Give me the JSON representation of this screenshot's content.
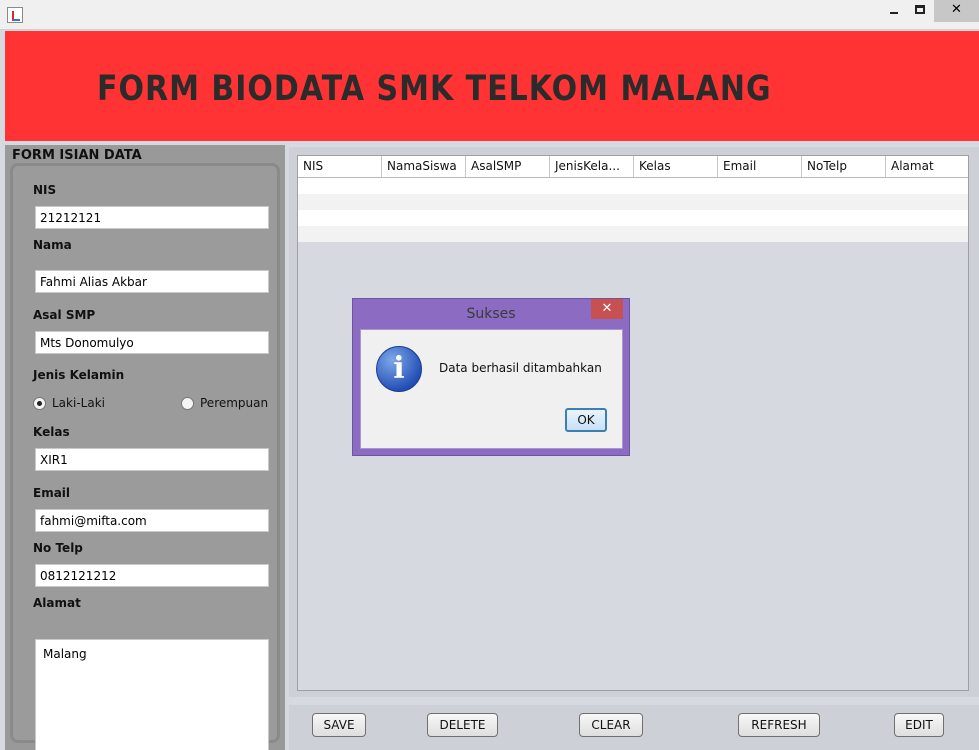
{
  "window": {
    "minimize_glyph": "",
    "maximize_glyph": "",
    "close_glyph": "✕"
  },
  "banner": {
    "title": "FORM BIODATA SMK TELKOM MALANG",
    "background": "#ff3333"
  },
  "form": {
    "title": "FORM ISIAN DATA",
    "nis_label": "NIS",
    "nis_value": "21212121",
    "nama_label": "Nama",
    "nama_value": "Fahmi Alias Akbar",
    "asal_smp_label": "Asal SMP",
    "asal_smp_value": "Mts Donomulyo",
    "jenis_kelamin_label": "Jenis Kelamin",
    "gender_options": [
      "Laki-Laki",
      "Perempuan"
    ],
    "gender_selected": "Laki-Laki",
    "kelas_label": "Kelas",
    "kelas_value": "XIR1",
    "email_label": "Email",
    "email_value": "fahmi@mifta.com",
    "no_telp_label": "No Telp",
    "no_telp_value": "0812121212",
    "alamat_label": "Alamat",
    "alamat_value": "Malang"
  },
  "table": {
    "columns": [
      "NIS",
      "NamaSiswa",
      "AsalSMP",
      "JenisKela...",
      "Kelas",
      "Email",
      "NoTelp",
      "Alamat"
    ],
    "rows": []
  },
  "buttons": {
    "save": "SAVE",
    "delete": "DELETE",
    "clear": "CLEAR",
    "refresh": "REFRESH",
    "edit": "EDIT"
  },
  "dialog": {
    "title": "Sukses",
    "close_glyph": "✕",
    "icon_glyph": "i",
    "message": "Data berhasil ditambahkan",
    "ok_label": "OK",
    "accent": "#8c6bc2"
  }
}
